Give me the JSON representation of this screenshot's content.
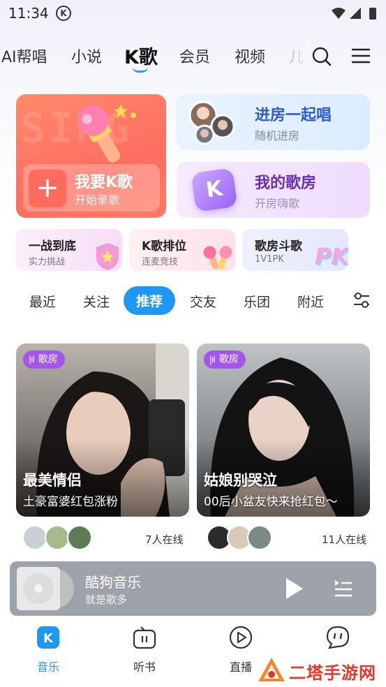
{
  "status_bar": {
    "time": "11:34",
    "app_badge": "K"
  },
  "top_tabs": {
    "items": [
      "AI帮唱",
      "小说",
      "K歌",
      "会员",
      "视频",
      "儿"
    ],
    "active": "K歌"
  },
  "features": {
    "sing": {
      "bg_text": "SING",
      "title": "我要K歌",
      "subtitle": "开始录歌"
    },
    "join_room": {
      "title": "进房一起唱",
      "subtitle": "随机进房"
    },
    "my_room": {
      "badge": "K",
      "title": "我的歌房",
      "subtitle": "开房嗨歌"
    }
  },
  "small_cards": [
    {
      "title": "一战到底",
      "subtitle": "实力挑战"
    },
    {
      "title": "K歌排位",
      "subtitle": "连麦竞技"
    },
    {
      "title": "歌房斗歌",
      "subtitle": "1V1PK",
      "art": "PK"
    }
  ],
  "feed_tabs": {
    "items": [
      "最近",
      "关注",
      "推荐",
      "交友",
      "乐团",
      "附近"
    ],
    "active": "推荐"
  },
  "feed": [
    {
      "tag": "歌房",
      "title": "最美情侣",
      "subtitle": "土豪富婆红包涨粉",
      "online": "7人在线"
    },
    {
      "tag": "歌房",
      "title": "姑娘别哭泣",
      "subtitle": "00后小盆友快来抢红包～",
      "online": "11人在线"
    }
  ],
  "player": {
    "title": "酷狗音乐",
    "subtitle": "就是歌多"
  },
  "bottom_nav": [
    {
      "label": "音乐",
      "icon": "k-logo-icon",
      "active": true
    },
    {
      "label": "听书",
      "icon": "radio-icon",
      "active": false
    },
    {
      "label": "直播",
      "icon": "play-circle-icon",
      "active": false
    },
    {
      "label": "",
      "icon": "chat-face-icon",
      "active": false
    }
  ],
  "watermark": {
    "text": "二塔手游网"
  },
  "colors": {
    "accent": "#1f97f5",
    "sing_card": "#ff6e61",
    "room_title": "#2d5cd6",
    "myroom_title": "#6a2fb0",
    "room_tag": "#a357e8"
  }
}
